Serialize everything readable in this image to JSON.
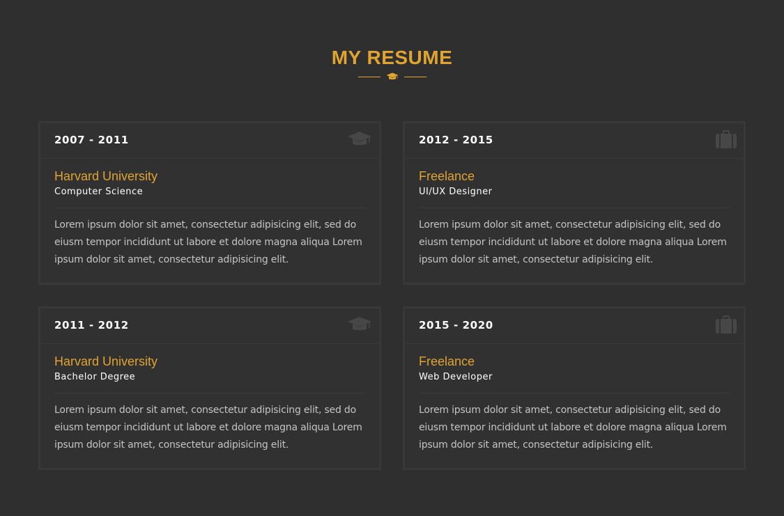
{
  "section": {
    "title": "MY RESUME",
    "icon": "graduation-cap-icon",
    "accent_color": "#e0a431"
  },
  "cards": [
    {
      "period": "2007 - 2011",
      "organization": "Harvard University",
      "role": "Computer Science",
      "description": "Lorem ipsum dolor sit amet, consectetur adipisicing elit, sed do eiusm tempor incididunt ut labore et dolore magna aliqua Lorem ipsum dolor sit amet, consectetur adipisicing elit.",
      "icon": "graduation-cap-icon"
    },
    {
      "period": "2012 - 2015",
      "organization": "Freelance",
      "role": "UI/UX Designer",
      "description": "Lorem ipsum dolor sit amet, consectetur adipisicing elit, sed do eiusm tempor incididunt ut labore et dolore magna aliqua Lorem ipsum dolor sit amet, consectetur adipisicing elit.",
      "icon": "briefcase-icon"
    },
    {
      "period": "2011 - 2012",
      "organization": "Harvard University",
      "role": "Bachelor Degree",
      "description": "Lorem ipsum dolor sit amet, consectetur adipisicing elit, sed do eiusm tempor incididunt ut labore et dolore magna aliqua Lorem ipsum dolor sit amet, consectetur adipisicing elit.",
      "icon": "graduation-cap-icon"
    },
    {
      "period": "2015 - 2020",
      "organization": "Freelance",
      "role": "Web Developer",
      "description": "Lorem ipsum dolor sit amet, consectetur adipisicing elit, sed do eiusm tempor incididunt ut labore et dolore magna aliqua Lorem ipsum dolor sit amet, consectetur adipisicing elit.",
      "icon": "briefcase-icon"
    }
  ]
}
